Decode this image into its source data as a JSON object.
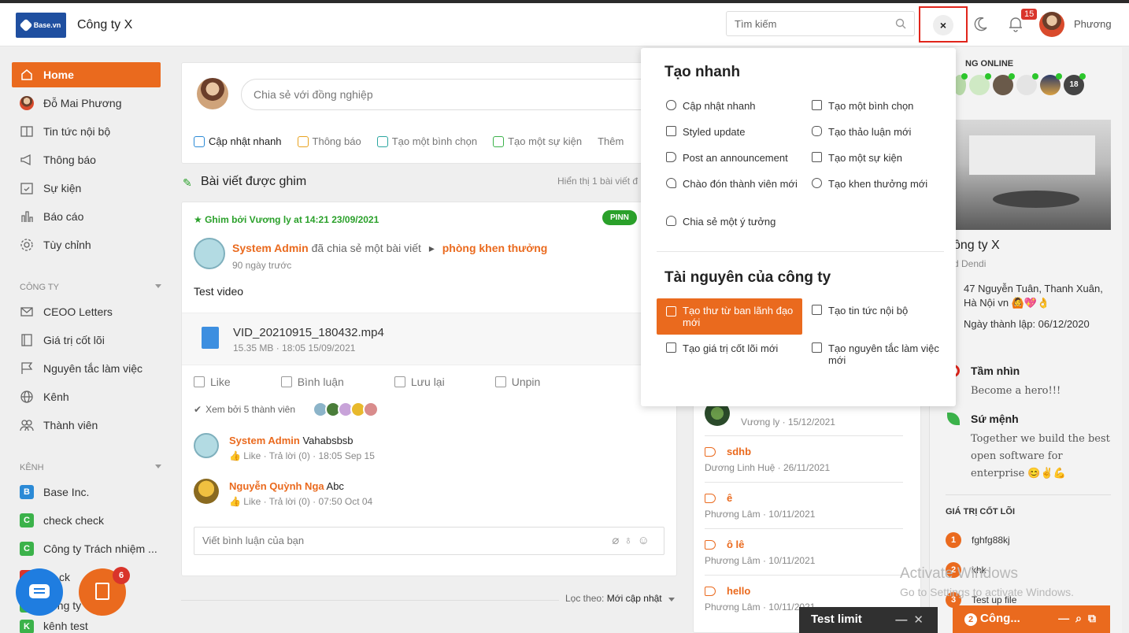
{
  "header": {
    "logo_text": "Base.vn",
    "company": "Công ty X",
    "search_placeholder": "Tìm kiếm",
    "close_label": "×",
    "notif_count": "15",
    "user_name": "Phương"
  },
  "sidebar": {
    "main": [
      {
        "label": "Home",
        "icon": "home-icon"
      },
      {
        "label": "Đỗ Mai Phương",
        "icon": "avatar"
      },
      {
        "label": "Tin tức nội bộ",
        "icon": "news-icon"
      },
      {
        "label": "Thông báo",
        "icon": "megaphone-icon"
      },
      {
        "label": "Sự kiện",
        "icon": "calendar-check-icon"
      },
      {
        "label": "Báo cáo",
        "icon": "bar-chart-icon"
      },
      {
        "label": "Tùy chỉnh",
        "icon": "gear-icon"
      }
    ],
    "section_company": "CÔNG TY",
    "company_items": [
      {
        "label": "CEOO Letters",
        "icon": "mail-icon"
      },
      {
        "label": "Giá trị cốt lõi",
        "icon": "book-icon"
      },
      {
        "label": "Nguyên tắc làm việc",
        "icon": "flag-icon"
      },
      {
        "label": "Kênh",
        "icon": "globe-icon"
      },
      {
        "label": "Thành viên",
        "icon": "users-icon"
      }
    ],
    "section_channel": "KÊNH",
    "channels": [
      {
        "letter": "B",
        "label": "Base Inc.",
        "color": "#2b8ad6"
      },
      {
        "letter": "C",
        "label": "check check",
        "color": "#3bb24a"
      },
      {
        "letter": "C",
        "label": "Công ty Trách nhiệm ...",
        "color": "#3bb24a"
      },
      {
        "letter": "",
        "label": "ck",
        "color": "#d9342b"
      },
      {
        "letter": "",
        "label": "ông ty",
        "color": "#3bb24a"
      },
      {
        "letter": "K",
        "label": "kênh test",
        "color": "#3bb24a"
      }
    ]
  },
  "composer": {
    "placeholder": "Chia sẻ với đồng nghiệp",
    "tabs": [
      "Cập nhật nhanh",
      "Thông báo",
      "Tạo một bình chọn",
      "Tạo một sự kiện",
      "Thêm"
    ]
  },
  "pinned": {
    "heading": "Bài viết được ghim",
    "count_text": "Hiển thị 1 bài viết đ",
    "pinned_by": "Ghim bởi Vương ly at 14:21 23/09/2021",
    "pin_tag": "PINN",
    "author": "System Admin",
    "action": "đã chia sẻ một bài viết",
    "group": "phòng khen thưởng",
    "time": "90 ngày trước",
    "body": "Test video",
    "file_name": "VID_20210915_180432.mp4",
    "file_meta": "15.35 MB · 18:05 15/09/2021",
    "actions": [
      "Like",
      "Bình luận",
      "Lưu lại",
      "Unpin"
    ],
    "seen_text": "Xem bởi 5 thành viên",
    "comments": [
      {
        "name": "System Admin",
        "text": "Vahabsbsb",
        "meta": "Like · Trả lời (0) · 18:05 Sep 15"
      },
      {
        "name": "Nguyễn Quỳnh Nga",
        "text": "Abc",
        "meta": "Like · Trả lời (0) · 07:50 Oct 04"
      }
    ],
    "comment_placeholder": "Viết bình luận của bạn",
    "filter_label": "Lọc theo:",
    "filter_value": "Mới cập nhật"
  },
  "announcements": [
    {
      "title": "",
      "meta": "Vương ly · 15/12/2021"
    },
    {
      "title": "sdhb",
      "meta": "Dương Linh Huệ · 26/11/2021"
    },
    {
      "title": "ê",
      "meta": "Phương Lâm · 10/11/2021"
    },
    {
      "title": "ô lê",
      "meta": "Phương Lâm · 10/11/2021"
    },
    {
      "title": "hello",
      "meta": "Phương Lâm · 10/11/2021"
    }
  ],
  "right": {
    "online_title": "NG ONLINE",
    "online_more": "18",
    "company_name": "ông ty X",
    "company_sub": "d Dendi",
    "address": "47 Nguyễn Tuân, Thanh Xuân, Hà Nội vn 🙆💖👌",
    "founded": "Ngày thành lập: 06/12/2020",
    "vision_title": "Tầm nhìn",
    "vision_text": "Become a hero!!!",
    "mission_title": "Sứ mệnh",
    "mission_text": "Together we build the best open software for enterprise 😊✌💪",
    "values_title": "GIÁ TRỊ CỐT LÕI",
    "values": [
      {
        "n": "1",
        "label": "fghfg88kj"
      },
      {
        "n": "2",
        "label": "khk"
      },
      {
        "n": "3",
        "label": "Test up file"
      }
    ]
  },
  "dropdown": {
    "quick_title": "Tạo nhanh",
    "quick_items": [
      {
        "label": "Cập nhật nhanh",
        "icon": "chat-icon"
      },
      {
        "label": "Tạo một bình chọn",
        "icon": "poll-icon"
      },
      {
        "label": "Styled update",
        "icon": "styled-icon"
      },
      {
        "label": "Tạo thảo luận mới",
        "icon": "discussion-icon"
      },
      {
        "label": "Post an announcement",
        "icon": "megaphone-icon"
      },
      {
        "label": "Tạo một sự kiện",
        "icon": "calendar-check-icon"
      },
      {
        "label": "Chào đón thành viên mới",
        "icon": "heart-icon"
      },
      {
        "label": "Tạo khen thưởng mới",
        "icon": "award-icon"
      },
      {
        "label": "Chia sẻ một ý tưởng",
        "icon": "bulb-icon"
      }
    ],
    "resource_title": "Tài nguyên của công ty",
    "resource_items": [
      {
        "label": "Tạo thư từ ban lãnh đạo mới",
        "icon": "mail-icon"
      },
      {
        "label": "Tạo tin tức nội bộ",
        "icon": "news-icon"
      },
      {
        "label": "Tạo giá trị cốt lõi mới",
        "icon": "book-icon"
      },
      {
        "label": "Tạo nguyên tắc làm việc mới",
        "icon": "flag-icon"
      }
    ]
  },
  "watermark": {
    "line1": "Activate Windows",
    "line2": "Go to Settings to activate Windows."
  },
  "chats": [
    {
      "title": "Test limit"
    },
    {
      "title": "Công...",
      "count": "2"
    }
  ],
  "fab_badge": "6"
}
